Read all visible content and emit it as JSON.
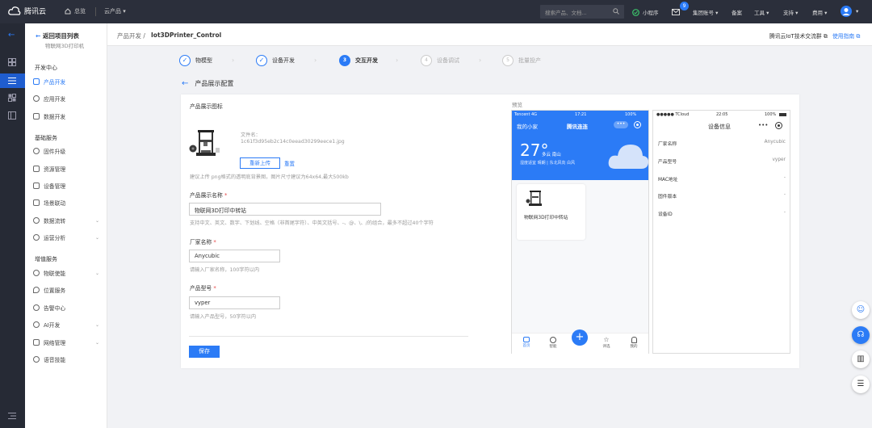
{
  "topnav": {
    "brand": "腾讯云",
    "home": "总览",
    "products": "云产品",
    "search_placeholder": "搜索产品、文档...",
    "mini_program": "小程序",
    "message_count": "9",
    "group_account": "集团账号",
    "record": "备案",
    "tools": "工具",
    "support": "支持",
    "fees": "费用"
  },
  "sidebar": {
    "back": "返回项目列表",
    "sub": "物联网3D打印机",
    "groups": [
      {
        "title": "开发中心"
      },
      {
        "title": "基础服务"
      },
      {
        "title": "增值服务"
      }
    ],
    "items": [
      {
        "label": "产品开发"
      },
      {
        "label": "应用开发"
      },
      {
        "label": "数据开发"
      },
      {
        "label": "固件升级"
      },
      {
        "label": "资源管理"
      },
      {
        "label": "设备管理"
      },
      {
        "label": "场景联动"
      },
      {
        "label": "数据流转"
      },
      {
        "label": "运营分析"
      },
      {
        "label": "物联使能"
      },
      {
        "label": "位置服务"
      },
      {
        "label": "告警中心"
      },
      {
        "label": "AI开发"
      },
      {
        "label": "网络管理"
      },
      {
        "label": "语音技能"
      }
    ]
  },
  "breadcrumb": {
    "parent": "产品开发",
    "separator": "/",
    "current": "Iot3DPrinter_Control",
    "exchange_group": "腾讯云IoT技术交流群",
    "guide": "使用指南"
  },
  "steps": [
    {
      "label": "物模型",
      "mark": "✓"
    },
    {
      "label": "设备开发",
      "mark": "✓"
    },
    {
      "label": "交互开发",
      "mark": "3"
    },
    {
      "label": "设备调试",
      "mark": "4"
    },
    {
      "label": "批量投产",
      "mark": "5"
    }
  ],
  "section_title": "产品展示配置",
  "form": {
    "icon_label": "产品展示图标",
    "file_name_label": "文件名：",
    "file_name": "1c61f3d95eb2c14c0eead30299eece1.jpg",
    "reupload": "重新上传",
    "reset": "重置",
    "icon_hint": "建议上传 png格式的透明底背景图，图片尺寸建议为64x64,最大500kb",
    "name_label": "产品展示名称",
    "name_value": "物联网3D打印中转站",
    "name_hint": "支持中文、英文、数字、下划线、空格（非首尾字符）、中英文括号、-、@、\\、/的组合，最多不超过40个字符",
    "vendor_label": "厂家名称",
    "vendor_value": "Anycubic",
    "vendor_hint": "请输入厂家名称，100字符以内",
    "model_label": "产品型号",
    "model_value": "vyper",
    "model_hint": "请输入产品型号，50字符以内",
    "save": "保存"
  },
  "preview": {
    "label": "预览",
    "phone1": {
      "carrier": "Tencent",
      "network": "4G",
      "time": "17:21",
      "battery": "100%",
      "home": "我的小家",
      "app": "腾讯连连",
      "temp": "27°",
      "weather": "多云 南山",
      "weather_detail": "湿度适宜 晴朗 | 东北风向 白风",
      "device_name": "物联网3D打印中转站",
      "tabs": [
        "首页",
        "智能",
        "",
        "评选",
        "我的"
      ]
    },
    "phone2": {
      "carrier": "●●●●● TCloud",
      "time": "22:05",
      "battery": "100%",
      "title": "设备信息",
      "rows": [
        {
          "k": "厂家名称",
          "v": "Anycubic"
        },
        {
          "k": "产品型号",
          "v": "vyper"
        },
        {
          "k": "MAC地址",
          "v": "-"
        },
        {
          "k": "固件版本",
          "v": "-"
        },
        {
          "k": "设备ID",
          "v": "-"
        }
      ]
    }
  },
  "colors": {
    "accent": "#2b7bf6",
    "topnav": "#2b2f3b",
    "rail": "#262a35"
  }
}
